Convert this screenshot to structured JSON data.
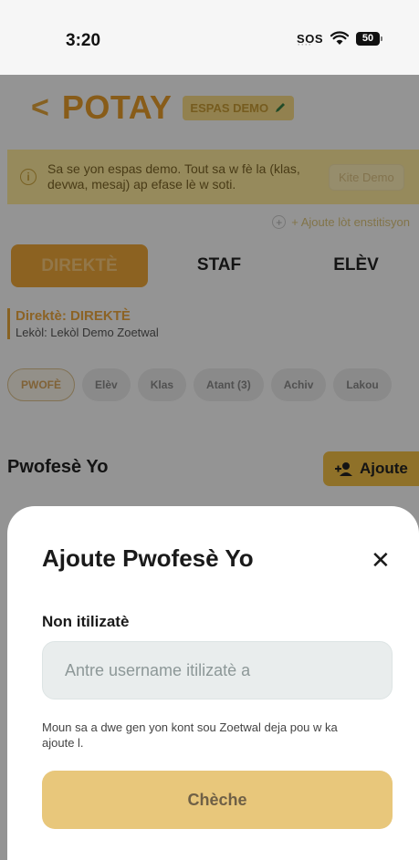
{
  "status_bar": {
    "time": "3:20",
    "sos": "SOS",
    "battery": "50",
    "wifi_icon": "wifi-icon"
  },
  "header": {
    "back_icon": "chevron-left-icon",
    "brand": "POTAY",
    "demo_badge": "ESPAS DEMO",
    "badge_icon": "pencil-icon"
  },
  "banner": {
    "icon": "info-icon",
    "text": "Sa se yon espas demo. Tout sa w fè la (klas, devwa, mesaj) ap efase lè w soti.",
    "button": "Kite Demo"
  },
  "add_institution": "+ Ajoute lòt enstitisyon",
  "role_tabs": [
    "DIREKTÈ",
    "STAF",
    "ELÈV"
  ],
  "director": {
    "title": "Direktè: DIREKTÈ",
    "school": "Lekòl: Lekòl Demo Zoetwal"
  },
  "chips": [
    "PWOFÈ",
    "Elèv",
    "Klas",
    "Atant (3)",
    "Achiv",
    "Lakou"
  ],
  "section": {
    "title": "Pwofesè Yo",
    "add_label": "Ajoute"
  },
  "sheet": {
    "title": "Ajoute Pwofesè Yo",
    "close": "✕",
    "field_label": "Non itilizatè",
    "input_placeholder": "Antre username itilizatè a",
    "input_value": "",
    "helper": "Moun sa a dwe gen yon kont sou Zoetwal deja pou w ka ajoute l.",
    "button": "Chèche"
  },
  "colors": {
    "accent": "#e9a437",
    "brand": "#e39a2a",
    "banner_bg": "#fae79a",
    "button_bg": "#e8c77b"
  }
}
